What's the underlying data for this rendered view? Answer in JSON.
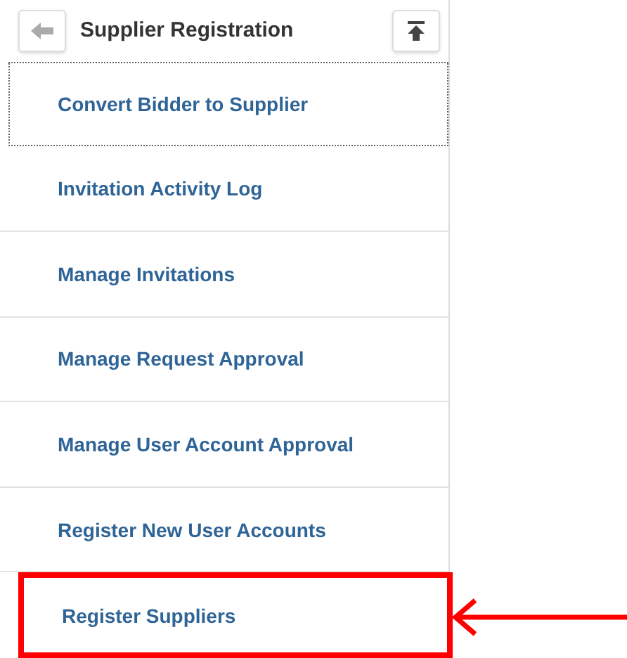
{
  "header": {
    "title": "Supplier Registration"
  },
  "items": [
    {
      "label": "Convert Bidder to Supplier",
      "focused": true,
      "highlighted": false
    },
    {
      "label": "Invitation Activity Log",
      "focused": false,
      "highlighted": false
    },
    {
      "label": "Manage Invitations",
      "focused": false,
      "highlighted": false
    },
    {
      "label": "Manage Request Approval",
      "focused": false,
      "highlighted": false
    },
    {
      "label": "Manage User Account Approval",
      "focused": false,
      "highlighted": false
    },
    {
      "label": "Register New User Accounts",
      "focused": false,
      "highlighted": false
    },
    {
      "label": "Register Suppliers",
      "focused": false,
      "highlighted": true
    }
  ]
}
